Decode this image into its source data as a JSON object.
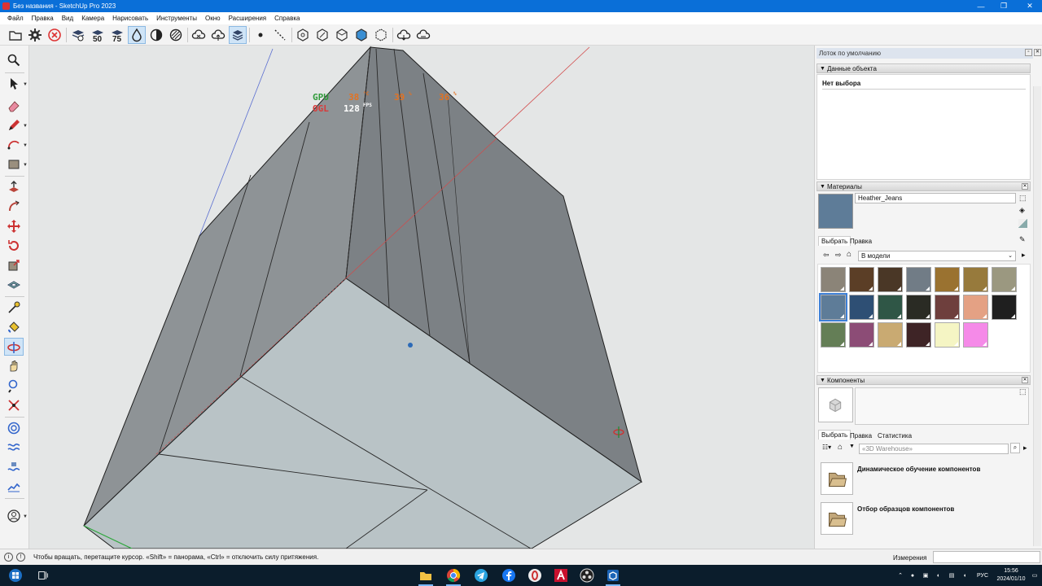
{
  "window": {
    "title": "Без названия - SketchUp Pro 2023",
    "controls": [
      "—",
      "❐",
      "✕"
    ]
  },
  "menu": [
    "Файл",
    "Правка",
    "Вид",
    "Камера",
    "Нарисовать",
    "Инструменты",
    "Окно",
    "Расширения",
    "Справка"
  ],
  "toolbar": {
    "label_50": "50",
    "label_75": "75"
  },
  "hud": {
    "gpu_label": "GPU",
    "gpu_temp": "38",
    "gpu_temp_unit": "°C",
    "val2": "39",
    "val2_unit": "%",
    "val3": "36",
    "val3_unit": "%",
    "ogl_label": "OGL",
    "fps": "128",
    "fps_unit": "FPS"
  },
  "tray": {
    "title": "Лоток по умолчанию",
    "entity_info": {
      "header": "Данные объекта",
      "status": "Нет выбора"
    },
    "materials": {
      "header": "Материалы",
      "current_name": "Heather_Jeans",
      "current_color": "#5e7c98",
      "tabs": [
        "Выбрать",
        "Правка"
      ],
      "collection": "В модели",
      "swatches": [
        "#8b8478",
        "#5b3e26",
        "#4a3726",
        "#717c86",
        "#9a7230",
        "#977a3c",
        "#9b9880",
        "#5e7c98",
        "#2e4f74",
        "#2f5646",
        "#2a2b24",
        "#6e3f3d",
        "#e4a184",
        "#1f1f1f",
        "#647e56",
        "#8c4c76",
        "#c9aa72",
        "#3e2426",
        "#f5f5c4",
        "#f58ae8"
      ]
    },
    "components": {
      "header": "Компоненты",
      "tabs": [
        "Выбрать",
        "Правка",
        "Статистика"
      ],
      "search_placeholder": "«3D Warehouse»",
      "items": [
        {
          "title": "Динамическое обучение компонентов"
        },
        {
          "title": "Отбор образцов компонентов"
        }
      ]
    }
  },
  "status": {
    "text": "Чтобы вращать, перетащите курсор. «Shift» = панорама, «Ctrl» = отключить силу притяжения.",
    "measure_label": "Измерения",
    "measure_value": ""
  },
  "taskbar": {
    "lang": "РУС",
    "time": "15:56",
    "date": "2024/01/10"
  }
}
